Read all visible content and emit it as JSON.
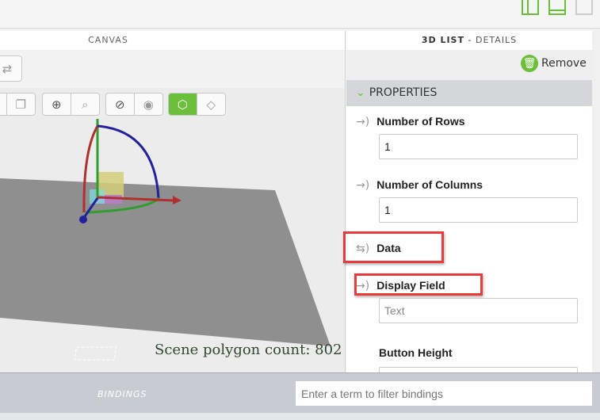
{
  "canvas": {
    "title": "CANVAS",
    "polygon_count": "Scene polygon count: 802"
  },
  "details": {
    "title_bold": "3D LIST",
    "title_sep": " - ",
    "title_rest": "DETAILS",
    "remove_label": "Remove",
    "section": "PROPERTIES",
    "properties": [
      {
        "label": "Number of Rows",
        "value": "1"
      },
      {
        "label": "Number of Columns",
        "value": "1"
      },
      {
        "label": "Data"
      },
      {
        "label": "Display Field",
        "placeholder": "Text"
      },
      {
        "label": "Button Height",
        "value": ""
      }
    ]
  },
  "bindings": {
    "label": "BINDINGS",
    "filter_placeholder": "Enter a term to filter bindings"
  },
  "colors": {
    "accent": "#6bbf3a",
    "highlight": "#e83c3c"
  }
}
